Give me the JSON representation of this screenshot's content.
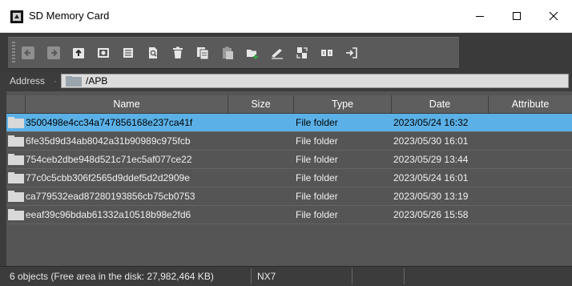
{
  "window": {
    "title": "SD Memory Card"
  },
  "toolbar": {
    "buttons": [
      {
        "icon": "back-arrow-icon"
      },
      {
        "icon": "forward-arrow-icon"
      },
      {
        "icon": "up-folder-icon"
      },
      {
        "icon": "drive-icon"
      },
      {
        "icon": "properties-icon"
      },
      {
        "icon": "search-icon"
      },
      {
        "icon": "delete-icon"
      },
      {
        "icon": "copy-icon"
      },
      {
        "icon": "paste-icon"
      },
      {
        "icon": "new-folder-icon"
      },
      {
        "icon": "rename-icon"
      },
      {
        "icon": "transfer-icon"
      },
      {
        "icon": "compare-icon"
      },
      {
        "icon": "exit-icon"
      }
    ]
  },
  "address": {
    "label": "Address",
    "path": "/APB"
  },
  "table": {
    "columns": [
      "Name",
      "Size",
      "Type",
      "Date",
      "Attribute"
    ],
    "rows": [
      {
        "name": "3500498e4cc34a747856168e237ca41f",
        "size": "",
        "type": "File folder",
        "date": "2023/05/24 16:32",
        "attribute": "",
        "selected": true
      },
      {
        "name": "6fe35d9d34ab8042a31b90989c975fcb",
        "size": "",
        "type": "File folder",
        "date": "2023/05/30 16:01",
        "attribute": ""
      },
      {
        "name": "754ceb2dbe948d521c71ec5af077ce22",
        "size": "",
        "type": "File folder",
        "date": "2023/05/29 13:44",
        "attribute": ""
      },
      {
        "name": "77c0c5cbb306f2565d9ddef5d2d2909e",
        "size": "",
        "type": "File folder",
        "date": "2023/05/24 16:01",
        "attribute": ""
      },
      {
        "name": "ca779532ead87280193856cb75cb0753",
        "size": "",
        "type": "File folder",
        "date": "2023/05/30 13:19",
        "attribute": ""
      },
      {
        "name": "eeaf39c96bdab61332a10518b98e2fd6",
        "size": "",
        "type": "File folder",
        "date": "2023/05/26 15:58",
        "attribute": ""
      }
    ]
  },
  "status": {
    "objects": "6 objects (Free area in the disk: 27,982,464 KB)",
    "device": "NX7"
  },
  "colors": {
    "selection": "#5bb1e7",
    "background": "#3c3c3c",
    "folder": "#d9d9d9"
  }
}
